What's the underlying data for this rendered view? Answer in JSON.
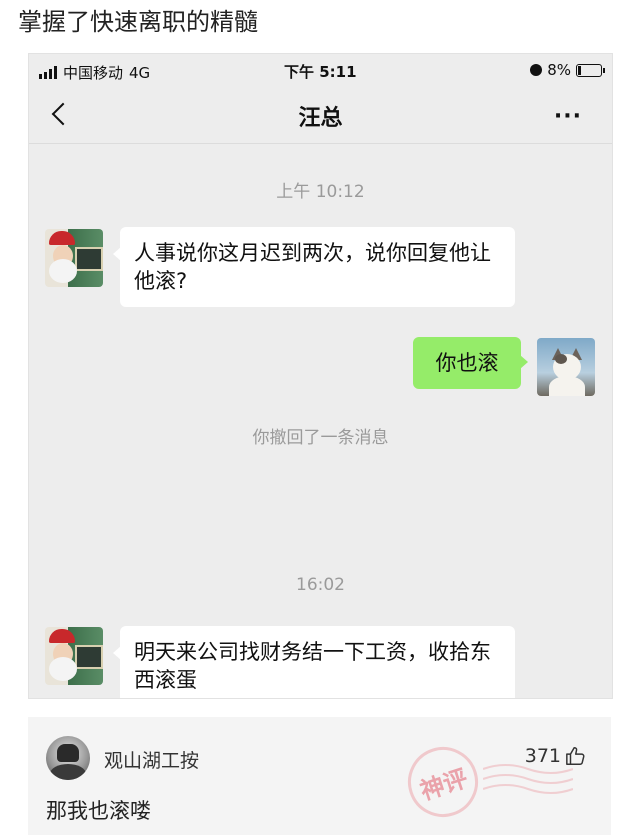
{
  "post": {
    "title": "掌握了快速离职的精髓"
  },
  "status_bar": {
    "carrier": "中国移动",
    "network": "4G",
    "time": "下午 5:11",
    "battery": "8%"
  },
  "nav": {
    "title": "汪总",
    "more": "···"
  },
  "chat": {
    "time1": "上午 10:12",
    "msg1": "人事说你这月迟到两次，说你回复他让他滚?",
    "msg2": "你也滚",
    "recall_notice": "你撤回了一条消息",
    "time2": "16:02",
    "msg3": "明天来公司找财务结一下工资，收拾东西滚蛋"
  },
  "comment": {
    "username": "观山湖工按",
    "likes": "371",
    "text": "那我也滚喽",
    "stamp": "神评"
  },
  "colors": {
    "chat_bg": "#ededed",
    "my_bubble": "#95ec69",
    "their_bubble": "#ffffff",
    "time_text": "#9a9a9a",
    "comment_bg": "#f4f4f4"
  },
  "icons": [
    "signal-icon",
    "alarm-icon",
    "battery-icon",
    "back-icon",
    "more-icon",
    "thumbs-up-icon"
  ]
}
